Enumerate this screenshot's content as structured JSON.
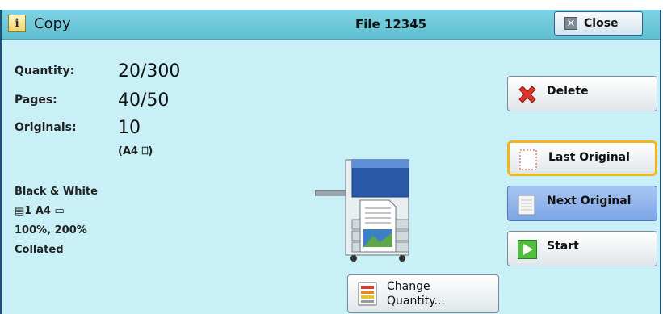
{
  "titlebar": {
    "app_title": "Copy",
    "file_name": "File 12345",
    "close_label": "Close",
    "info_glyph": "i"
  },
  "summary": {
    "quantity_label": "Quantity:",
    "quantity_value": "20/300",
    "pages_label": "Pages:",
    "pages_value": "40/50",
    "originals_label": "Originals:",
    "originals_value": "10",
    "original_size": "(A4 ⎕)"
  },
  "settings": {
    "color_mode": "Black & White",
    "tray_and_size": "▤1  A4 ▭",
    "zoom": "100%, 200%",
    "collation": "Collated"
  },
  "actions": {
    "delete_label": "Delete",
    "last_original_label": "Last Original",
    "next_original_label": "Next Original",
    "start_label": "Start",
    "change_quantity_line1": "Change",
    "change_quantity_line2": "Quantity..."
  },
  "icons": {
    "info": "info-icon",
    "close": "close-x-icon",
    "delete": "red-x-icon",
    "last_original": "dotted-page-icon",
    "next_original": "blank-page-icon",
    "start": "green-play-icon",
    "change_quantity": "document-list-icon",
    "device": "multifunction-printer-icon"
  },
  "colors": {
    "panel_bg": "#c8f0f6",
    "titlebar": "#6fc9da",
    "highlight_border": "#f2b51c",
    "next_button": "#8fb3ec"
  }
}
